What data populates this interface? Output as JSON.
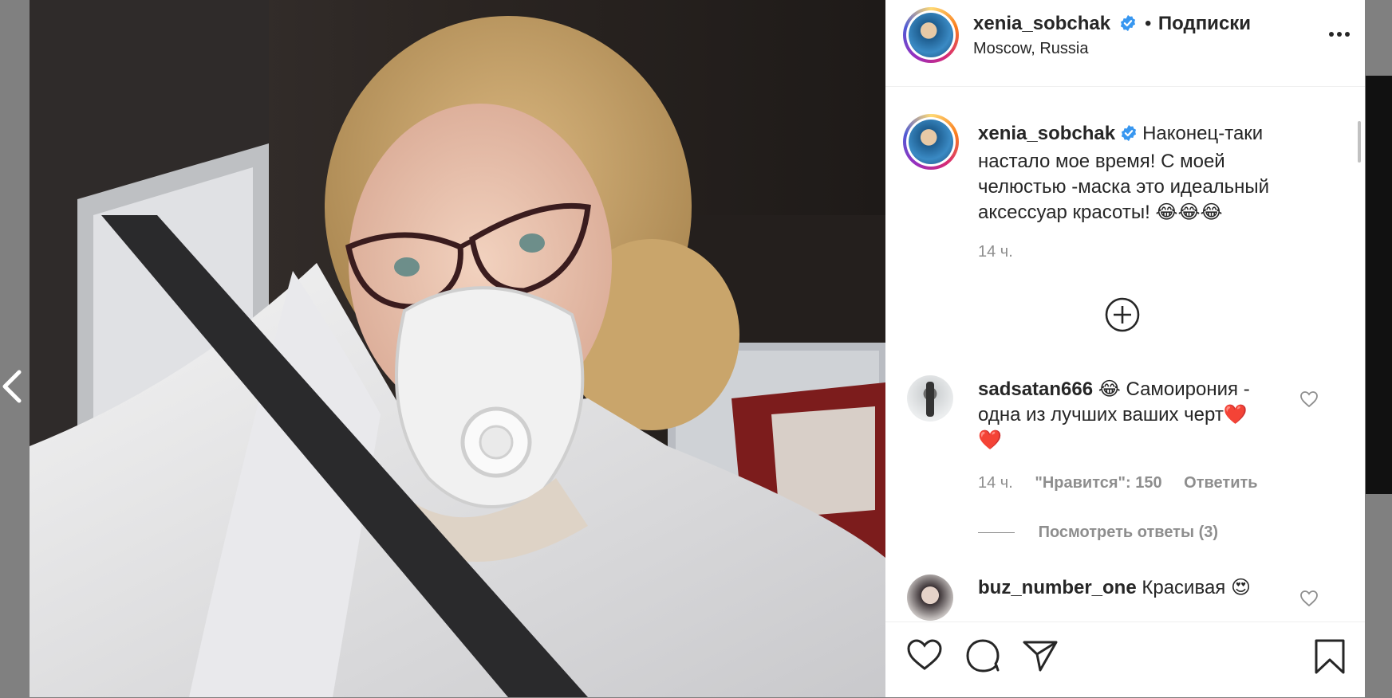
{
  "post": {
    "author": "xenia_sobchak",
    "follow_separator": "•",
    "follow_label": "Подписки",
    "location": "Moscow, Russia",
    "more_label": "•••",
    "caption_text": "Наконец-таки настало мое время! С моей челюстью -маска это идеальный аксессуар красоты! 😂😂😂",
    "caption_time": "14 ч."
  },
  "comments": [
    {
      "username": "sadsatan666",
      "text": "😂 Самоирония - одна из лучших ваших черт❤️❤️",
      "time": "14 ч.",
      "likes_label": "\"Нравится\": 150",
      "reply_label": "Ответить",
      "view_replies_label": "Посмотреть ответы (3)"
    },
    {
      "username": "buz_number_one",
      "text": "Красивая 😍"
    }
  ],
  "colors": {
    "accent_blue": "#3897f0",
    "text_primary": "#262626",
    "text_secondary": "#8e8e8e",
    "overlay": "#808080"
  },
  "icons": [
    "chevron-left-icon",
    "more-icon",
    "verified-icon",
    "add-comment-icon",
    "heart-icon",
    "comment-icon",
    "share-icon",
    "bookmark-icon"
  ]
}
